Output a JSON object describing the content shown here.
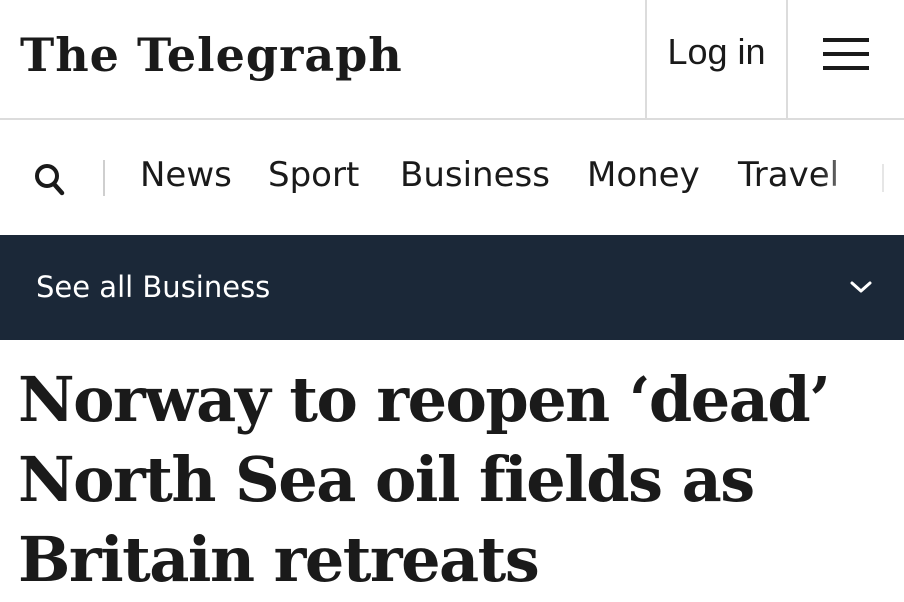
{
  "header": {
    "logo_text": "The Telegraph",
    "login_label": "Log in",
    "menu_icon": "hamburger-menu-icon"
  },
  "nav": {
    "search_icon": "search-icon",
    "items": [
      "News",
      "Sport",
      "Business",
      "Money",
      "Travel"
    ]
  },
  "section_bar": {
    "label": "See all Business",
    "chevron_icon": "chevron-down-icon",
    "background": "#1b2838"
  },
  "article": {
    "headline_lines": [
      "Norway to reopen ‘dead’",
      "North Sea oil fields as",
      "Britain retreats"
    ]
  }
}
